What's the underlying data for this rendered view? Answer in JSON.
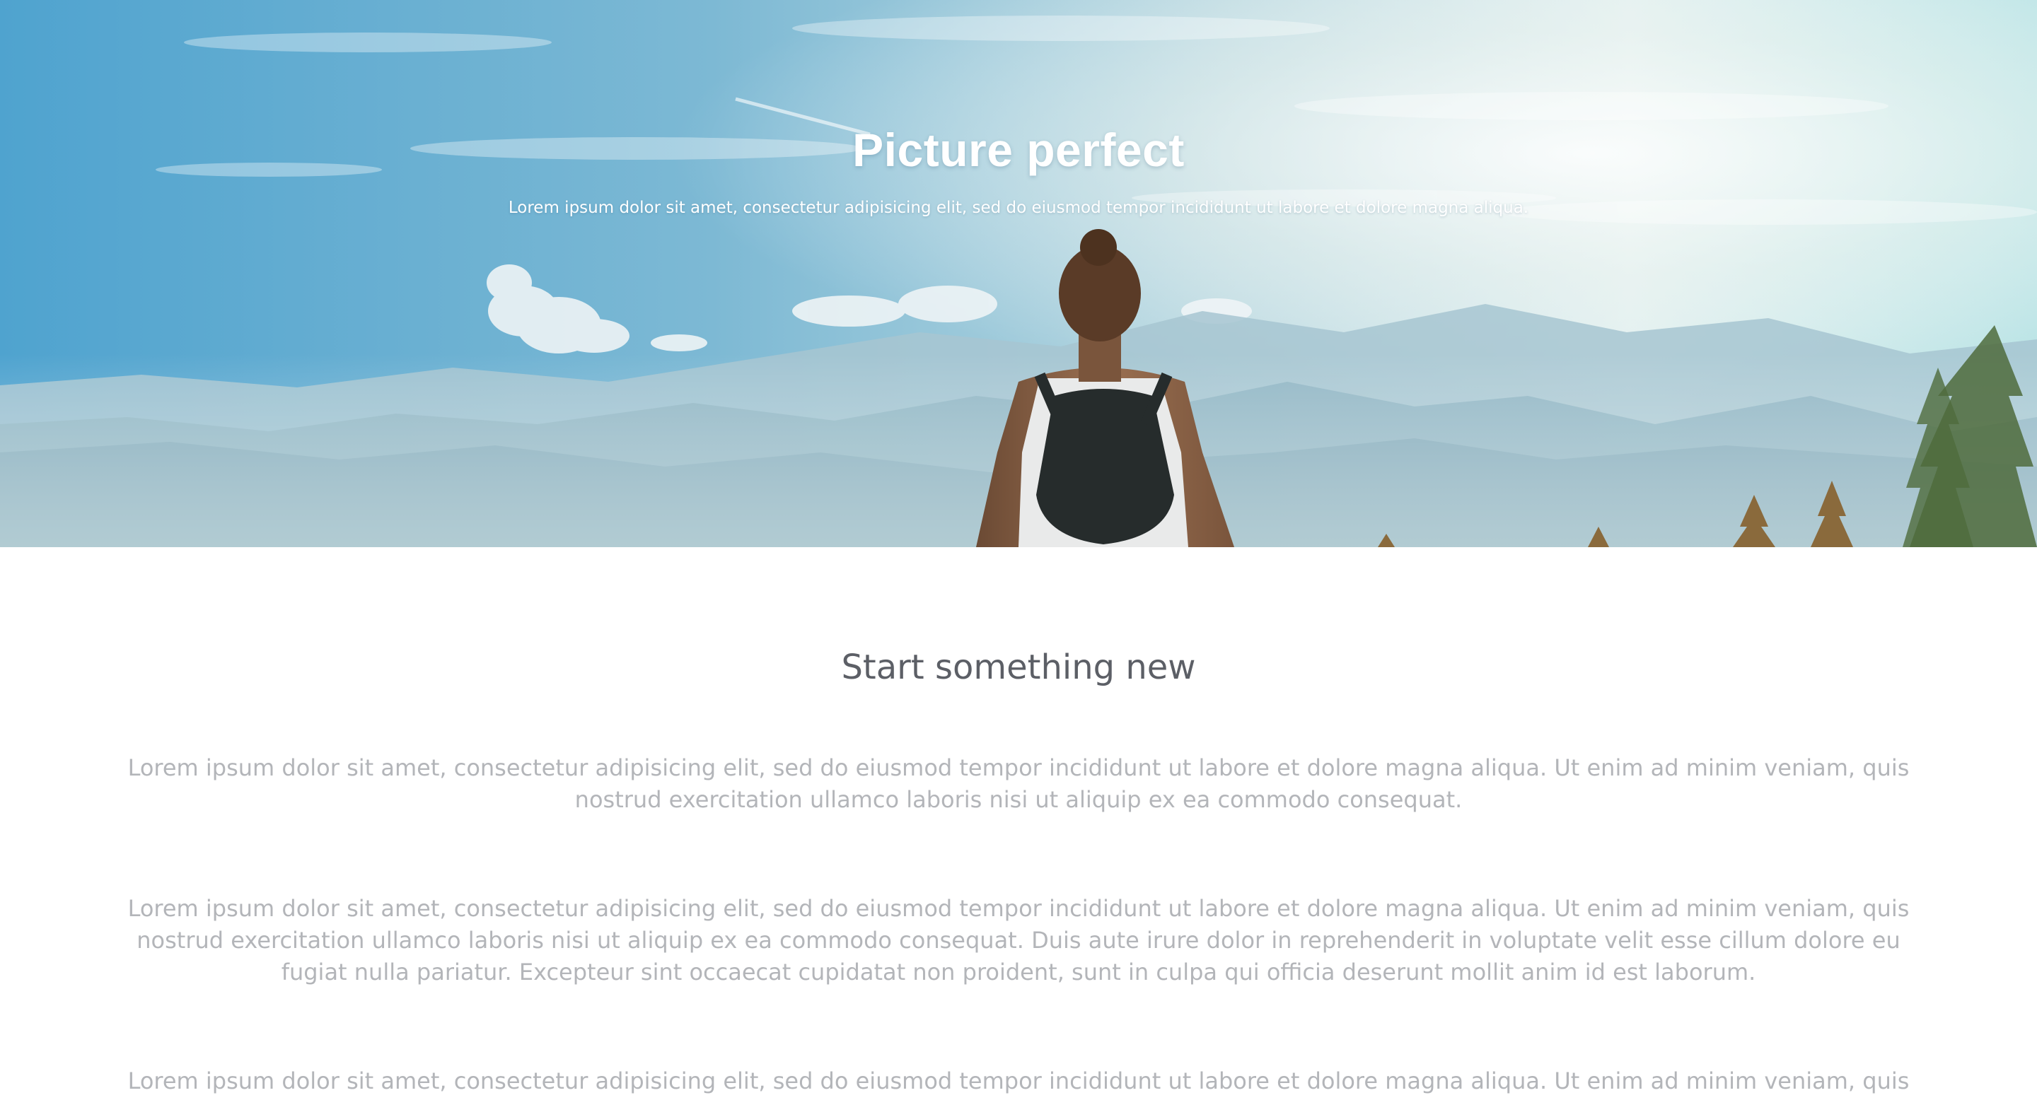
{
  "hero": {
    "title": "Picture perfect",
    "subtitle": "Lorem ipsum dolor sit amet, consectetur adipisicing elit, sed do eiusmod tempor incididunt ut labore et dolore magna aliqua.",
    "image": "hiker-with-backpack-facing-misty-mountains"
  },
  "section": {
    "heading": "Start something new",
    "paragraphs": [
      "Lorem ipsum dolor sit amet, consectetur adipisicing elit, sed do eiusmod tempor incididunt ut labore et dolore magna aliqua. Ut enim ad minim veniam, quis nostrud exercitation ullamco laboris nisi ut aliquip ex ea commodo consequat.",
      "Lorem ipsum dolor sit amet, consectetur adipisicing elit, sed do eiusmod tempor incididunt ut labore et dolore magna aliqua. Ut enim ad minim veniam, quis nostrud exercitation ullamco laboris nisi ut aliquip ex ea commodo consequat. Duis aute irure dolor in reprehenderit in voluptate velit esse cillum dolore eu fugiat nulla pariatur. Excepteur sint occaecat cupidatat non proident, sunt in culpa qui officia deserunt mollit anim id est laborum.",
      "Lorem ipsum dolor sit amet, consectetur adipisicing elit, sed do eiusmod tempor incididunt ut labore et dolore magna aliqua. Ut enim ad minim veniam, quis nostrud"
    ]
  },
  "colors": {
    "heading": "#5c5f66",
    "body_text": "#b3b5b9",
    "hero_text": "#ffffff",
    "sky": "#5fa9cf"
  }
}
